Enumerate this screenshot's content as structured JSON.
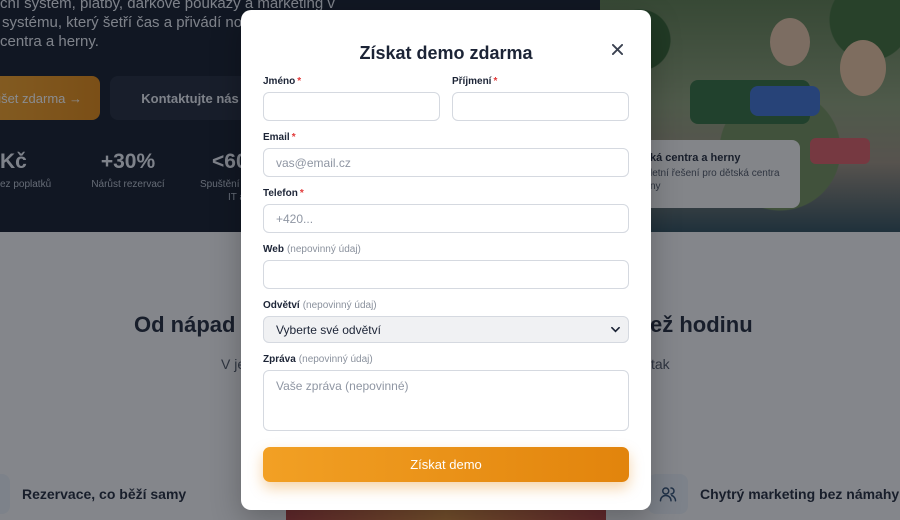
{
  "background": {
    "hero_lines": [
      "ční systém, platby, dárkové poukazy a marketing v",
      "systému, který šetří čas a přivádí nové",
      "centra a herny."
    ],
    "primary_button": "ušet zdarma →",
    "secondary_button": "Kontaktujte nás",
    "stats": [
      {
        "value": "Kč",
        "label": "ez poplatků"
      },
      {
        "value": "+30%",
        "label": "Nárůst rezervací"
      },
      {
        "value": "<60",
        "label": "Spuštění",
        "label2": "IT a"
      }
    ],
    "photo_card": {
      "title": "ká centra a herny",
      "subtitle": "letní řešení pro dětská centra",
      "subtitle2": "ny"
    },
    "section_title_left": "Od nápad",
    "section_title_right": "ež hodinu",
    "section_sub_left": "V je",
    "section_sub_right": "tak",
    "features": [
      {
        "label": "Rezervace, co běží samy",
        "icon": "calendar-icon"
      },
      {
        "label": "Chytrý marketing bez námahy",
        "icon": "users-icon"
      }
    ]
  },
  "modal": {
    "title": "Získat demo zdarma",
    "close_icon": "close-icon",
    "fields": {
      "first_name": {
        "label": "Jméno",
        "required": "*",
        "value": "",
        "placeholder": ""
      },
      "last_name": {
        "label": "Příjmení",
        "required": "*",
        "value": "",
        "placeholder": ""
      },
      "email": {
        "label": "Email",
        "required": "*",
        "placeholder": "vas@email.cz"
      },
      "phone": {
        "label": "Telefon",
        "required": "*",
        "placeholder": "+420..."
      },
      "web": {
        "label": "Web",
        "optional": "(nepovinný údaj)",
        "placeholder": ""
      },
      "industry": {
        "label": "Odvětví",
        "optional": "(nepovinný údaj)",
        "selected": "Vyberte své odvětví"
      },
      "message": {
        "label": "Zpráva",
        "optional": "(nepovinný údaj)",
        "placeholder": "Vaše zpráva (nepovinné)"
      }
    },
    "submit_label": "Získat demo"
  },
  "colors": {
    "accent": "#EE9417",
    "required_star": "#E23A3A",
    "overlay": "rgba(20,24,32,0.5)"
  }
}
